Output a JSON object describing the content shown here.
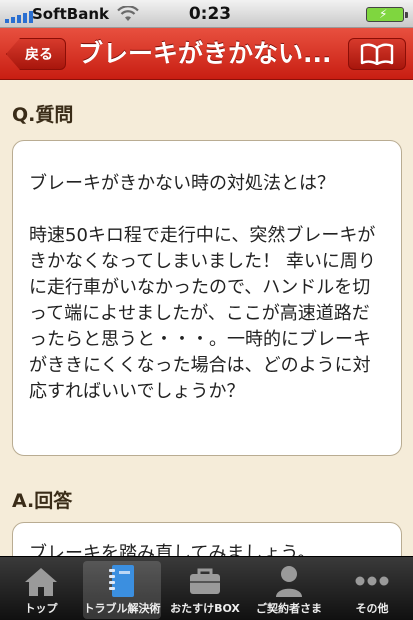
{
  "status_bar": {
    "carrier": "SoftBank",
    "time": "0:23"
  },
  "nav": {
    "back_label": "戻る",
    "title": "ブレーキがきかない..."
  },
  "question": {
    "heading": "Q.質問",
    "body": "ブレーキがきかない時の対処法とは？\n\n時速50キロ程で走行中に、突然ブレーキがきかなくなってしまいました！ 幸いに周りに走行車がいなかったので、ハンドルを切って端によせましたが、ここが高速道路だったらと思うと・・・。一時的にブレーキがききにくくなった場合は、どのように対応すればいいでしょうか？"
  },
  "answer": {
    "heading": "A.回答",
    "body": "ブレーキを踏み直してみましょう。"
  },
  "tabs": [
    {
      "label": "トップ",
      "icon": "home-icon"
    },
    {
      "label": "トラブル解決術",
      "icon": "notebook-icon"
    },
    {
      "label": "おたすけBOX",
      "icon": "toolbox-icon"
    },
    {
      "label": "ご契約者さま",
      "icon": "person-icon"
    },
    {
      "label": "その他",
      "icon": "more-icon"
    }
  ],
  "colors": {
    "accent": "#c81e12",
    "background": "#f5ecd9",
    "tab_active_icon": "#3b8fe0"
  }
}
